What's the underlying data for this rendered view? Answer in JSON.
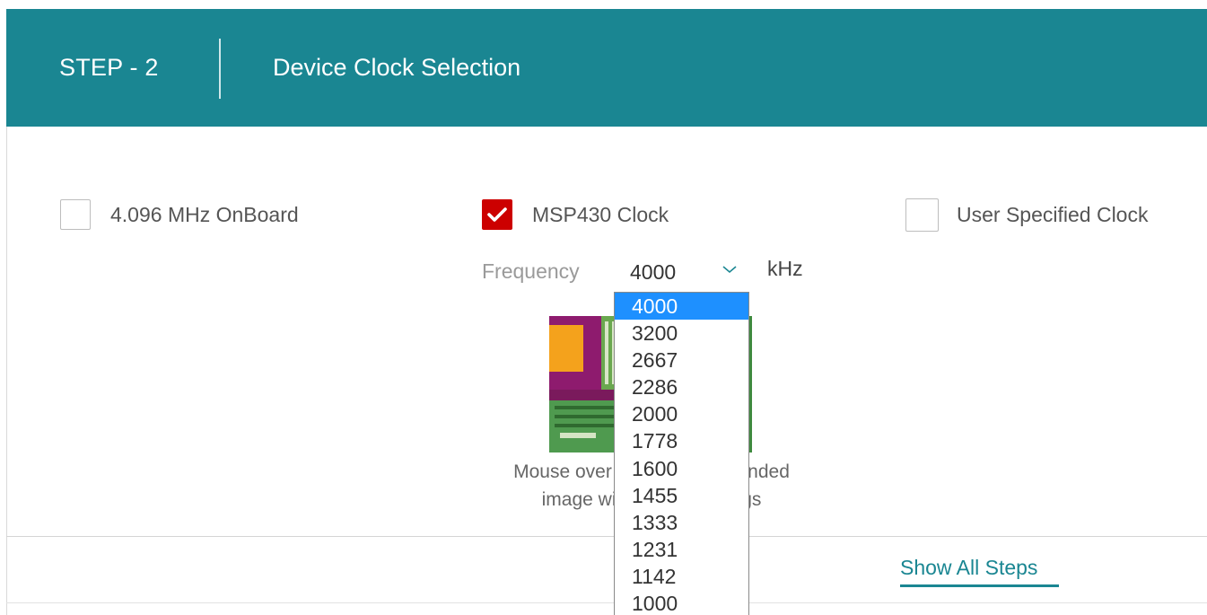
{
  "header": {
    "step": "STEP - 2",
    "title": "Device Clock Selection",
    "background_color": "#1a8692"
  },
  "clock_options": [
    {
      "label": "4.096 MHz OnBoard",
      "checked": false
    },
    {
      "label": "MSP430 Clock",
      "checked": true
    },
    {
      "label": "User Specified Clock",
      "checked": false
    }
  ],
  "frequency": {
    "label": "Frequency",
    "selected": "4000",
    "unit": "kHz",
    "chevron_icon": "chevron-down-icon",
    "options": [
      "4000",
      "3200",
      "2667",
      "2286",
      "2000",
      "1778",
      "1600",
      "1455",
      "1333",
      "1231",
      "1142",
      "1000"
    ]
  },
  "board": {
    "caption_line1": "Mouse over",
    "caption_line1_tail": "anded",
    "caption_line2": "image wi",
    "caption_line2_tail": "gs"
  },
  "footer": {
    "show_all_steps": "Show All Steps"
  },
  "colors": {
    "accent": "#1a8692",
    "checked_box": "#cc0000",
    "dropdown_highlight": "#1e90ff"
  }
}
